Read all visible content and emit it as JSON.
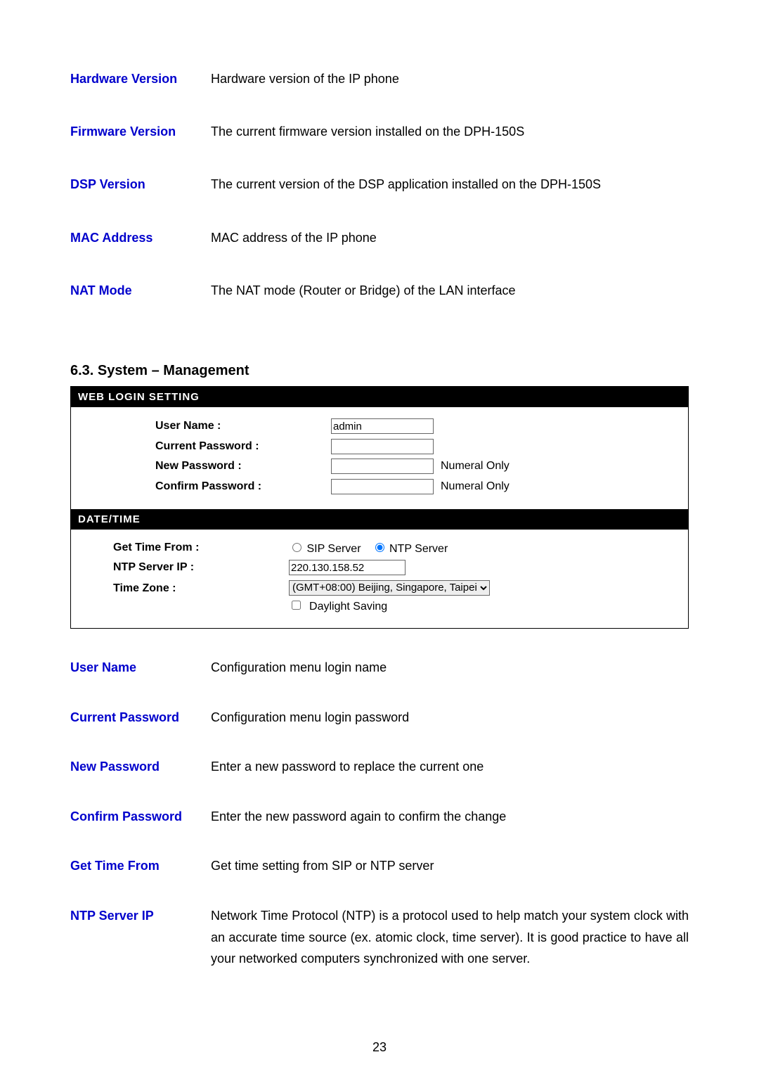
{
  "top_defs": [
    {
      "term": "Hardware Version",
      "desc": "Hardware version of the IP phone"
    },
    {
      "term": "Firmware Version",
      "desc": "The current firmware version installed on the DPH-150S"
    },
    {
      "term": "DSP Version",
      "desc": "The current version of the DSP application installed on the DPH-150S"
    },
    {
      "term": "MAC Address",
      "desc": "MAC address of the IP phone"
    },
    {
      "term": "NAT Mode",
      "desc": "The NAT mode (Router or Bridge) of the LAN interface"
    }
  ],
  "section_heading": "6.3.  System – Management",
  "web_login": {
    "header": "WEB LOGIN SETTING",
    "username_label": "User Name :",
    "username_value": "admin",
    "current_pw_label": "Current Password :",
    "current_pw_value": "",
    "new_pw_label": "New Password :",
    "new_pw_value": "",
    "new_pw_hint": "Numeral Only",
    "confirm_pw_label": "Confirm Password :",
    "confirm_pw_value": "",
    "confirm_pw_hint": "Numeral Only"
  },
  "datetime": {
    "header": "DATE/TIME",
    "get_time_label": "Get Time From :",
    "radio_sip_label": "SIP Server",
    "radio_ntp_label": "NTP Server",
    "radio_selected": "ntp",
    "ntp_ip_label": "NTP Server IP :",
    "ntp_ip_value": "220.130.158.52",
    "tz_label": "Time Zone :",
    "tz_value": "(GMT+08:00) Beijing, Singapore, Taipei",
    "daylight_label": "Daylight Saving",
    "daylight_checked": false
  },
  "bottom_defs": [
    {
      "term": "User Name",
      "desc": "Configuration menu login name"
    },
    {
      "term": "Current Password",
      "desc": "Configuration menu login password"
    },
    {
      "term": "New Password",
      "desc": "Enter a new password to replace the current one"
    },
    {
      "term": "Confirm Password",
      "desc": "Enter the new password again to confirm the change"
    },
    {
      "term": "Get Time From",
      "desc": "Get time setting from SIP or NTP server"
    },
    {
      "term": "NTP Server IP",
      "desc": "Network Time Protocol (NTP) is a protocol used to help match your system clock with an accurate time source (ex. atomic clock, time server). It is good practice to have all your networked computers synchronized with one server."
    }
  ],
  "page_number": "23"
}
